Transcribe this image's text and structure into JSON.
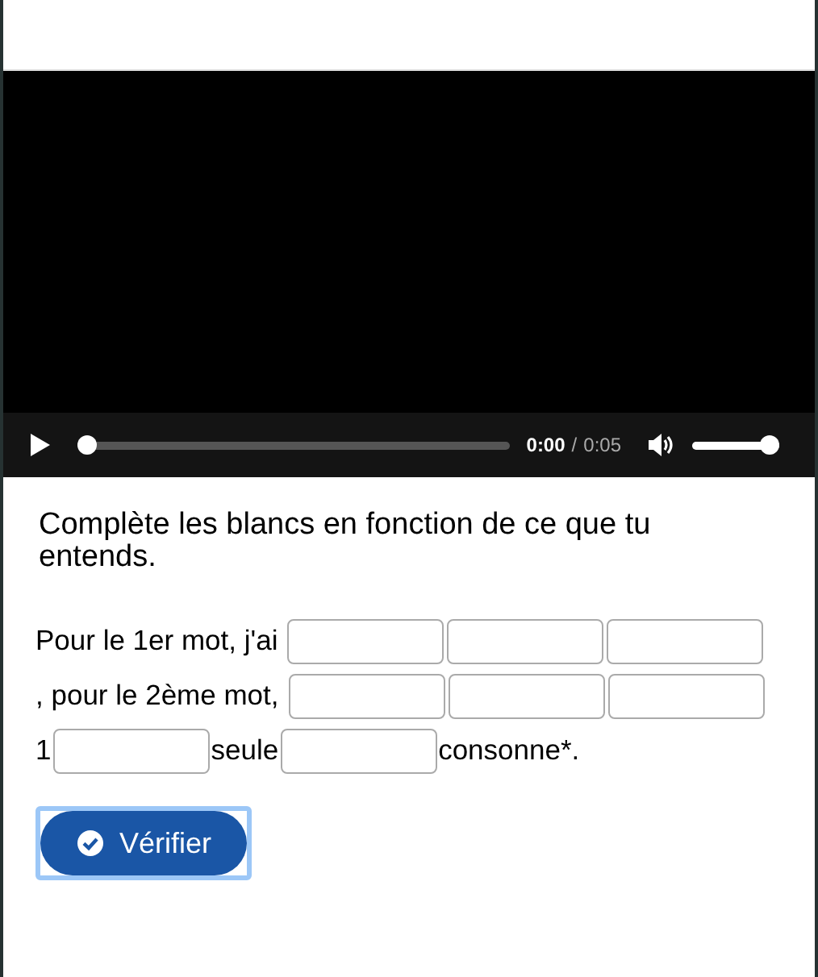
{
  "video_player": {
    "current_time": "0:00",
    "separator": "/",
    "duration": "0:05",
    "progress": {
      "level": 0
    },
    "volume": {
      "level": 1,
      "muted": false
    }
  },
  "instructions": "Complète les blancs en fonction de ce que tu entends.",
  "cloze": [
    {
      "kind": "text",
      "text": "Pour le 1er mot, j'ai "
    },
    {
      "kind": "blank"
    },
    {
      "kind": "blank"
    },
    {
      "kind": "blank"
    },
    {
      "kind": "text",
      "text": ", pour le 2ème mot, "
    },
    {
      "kind": "blank"
    },
    {
      "kind": "blank"
    },
    {
      "kind": "blank"
    },
    {
      "kind": "text",
      "text": "1"
    },
    {
      "kind": "blank"
    },
    {
      "kind": "text",
      "text": "seule"
    },
    {
      "kind": "blank"
    },
    {
      "kind": "text",
      "text": "consonne*."
    }
  ],
  "verify_button": {
    "label": "Vérifier",
    "focused": true
  }
}
